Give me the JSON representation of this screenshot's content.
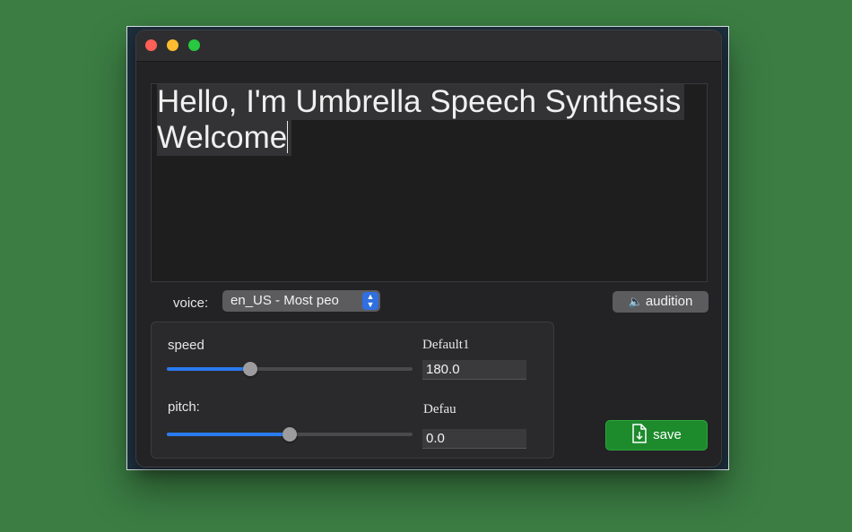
{
  "window": {
    "controls": [
      "close",
      "minimize",
      "zoom"
    ]
  },
  "editor": {
    "lines": [
      "Hello, I'm Umbrella Speech Synthesis",
      "Welcome"
    ]
  },
  "voice": {
    "label": "voice:",
    "selected": "en_US  -  Most peo"
  },
  "audition": {
    "icon": "speaker-icon",
    "label": "audition"
  },
  "speed": {
    "label": "speed",
    "caption": "Default1",
    "value": "180.0",
    "slider_fraction": 0.34
  },
  "pitch": {
    "label": "pitch:",
    "caption": "Defau",
    "value": "0.0",
    "slider_fraction": 0.5
  },
  "save": {
    "icon": "file-download-icon",
    "label": "save"
  },
  "colors": {
    "accent": "#2b7bf1",
    "save_button": "#1d8a2c",
    "background": "#3b7d43"
  }
}
